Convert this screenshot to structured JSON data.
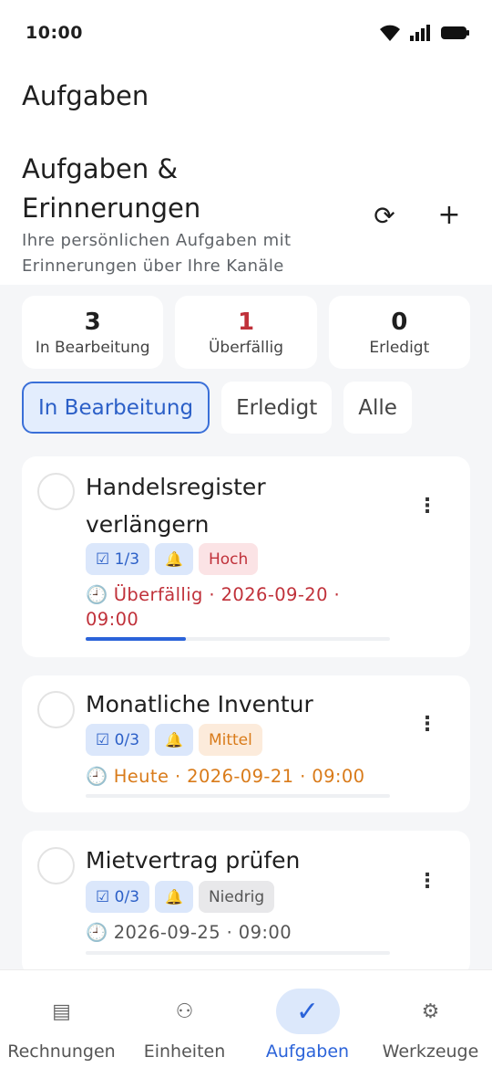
{
  "status_bar": {
    "time": "10:00",
    "icons": [
      "wifi-icon",
      "signal-icon",
      "battery-icon"
    ]
  },
  "app_title": "Aufgaben",
  "section": {
    "title": "Aufgaben & Erinnerungen",
    "subtitle": "Ihre persönlichen Aufgaben mit Erinnerungen über Ihre Kanäle",
    "refresh_icon": "⟳",
    "add_icon": "+"
  },
  "stats": [
    {
      "value": "3",
      "label": "In Bearbeitung"
    },
    {
      "value": "1",
      "label": "Überfällig"
    },
    {
      "value": "0",
      "label": "Erledigt"
    }
  ],
  "filters": [
    {
      "label": "In Bearbeitung",
      "selected": true
    },
    {
      "label": "Erledigt",
      "selected": false
    },
    {
      "label": "Alle",
      "selected": false
    }
  ],
  "tasks": [
    {
      "title": "Handelsregister verlängern",
      "subtasks": "☑ 1/3",
      "bell": "🔔",
      "priority": "Hoch",
      "clock": "🕘",
      "due": "Überfällig · 2026-09-20 · 09:00",
      "progress": 0.33
    },
    {
      "title": "Monatliche Inventur",
      "subtasks": "☑ 0/3",
      "bell": "🔔",
      "priority": "Mittel",
      "clock": "🕘",
      "due": "Heute · 2026-09-21 · 09:00",
      "progress": 0
    },
    {
      "title": "Mietvertrag prüfen",
      "subtasks": "☑ 0/3",
      "bell": "🔔",
      "priority": "Niedrig",
      "clock": "🕘",
      "due": "2026-09-25 · 09:00",
      "progress": 0
    }
  ],
  "menu_icon": "⋮",
  "bottom_nav": [
    {
      "label": "Rechnungen",
      "icon": "▤",
      "active": false
    },
    {
      "label": "Einheiten",
      "icon": "⚇",
      "active": false
    },
    {
      "label": "Aufgaben",
      "icon": "✓",
      "active": true
    },
    {
      "label": "Werkzeuge",
      "icon": "⚙",
      "active": false
    }
  ],
  "colors": {
    "accent": "#2b63d9",
    "overdue": "#c0313a",
    "today": "#d97b1a",
    "background": "#f5f6f8"
  }
}
